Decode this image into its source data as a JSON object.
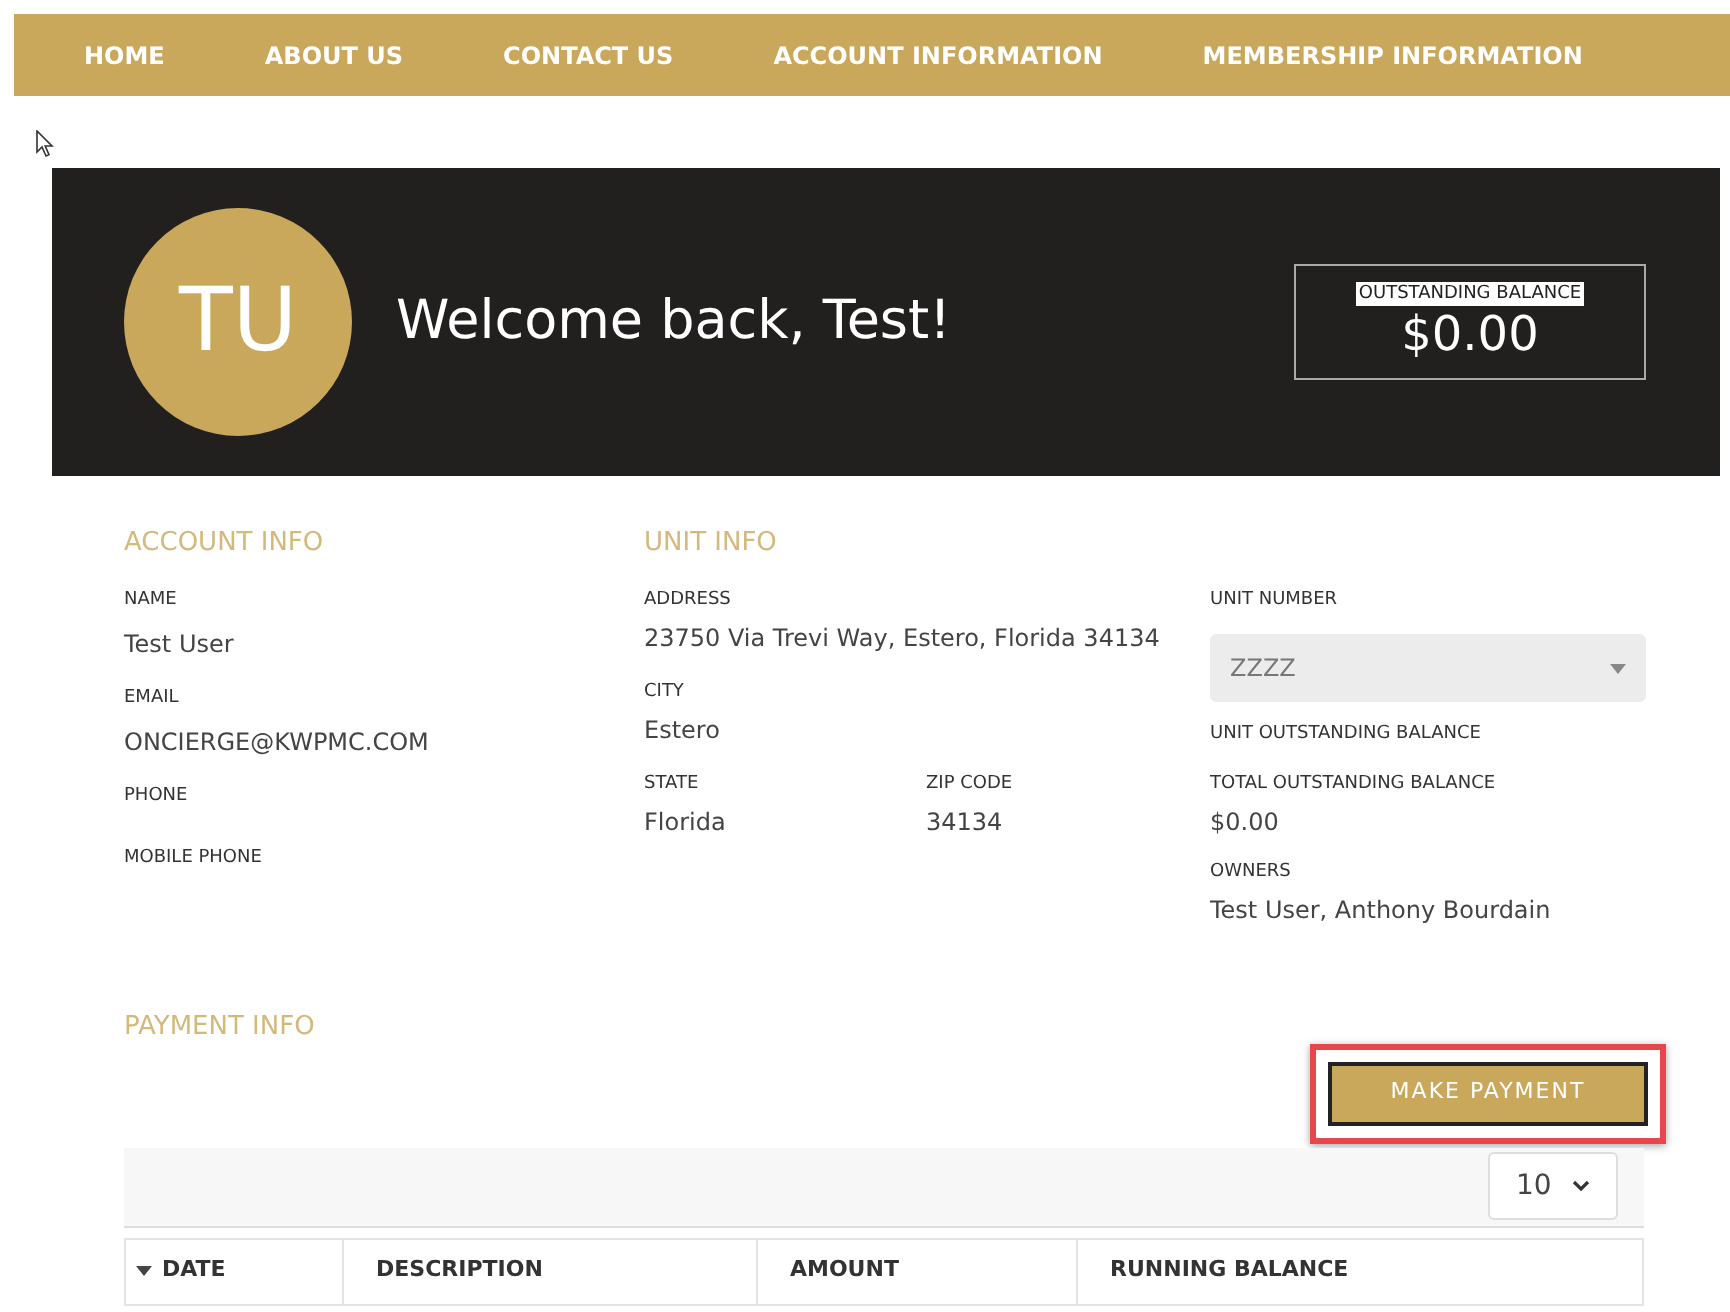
{
  "nav": [
    {
      "label": "HOME"
    },
    {
      "label": "ABOUT US"
    },
    {
      "label": "CONTACT US"
    },
    {
      "label": "ACCOUNT INFORMATION"
    },
    {
      "label": "MEMBERSHIP INFORMATION"
    }
  ],
  "banner": {
    "initials": "TU",
    "welcome": "Welcome back, Test!",
    "balance_label": "OUTSTANDING BALANCE",
    "balance_label_text_selected": true,
    "balance": "$0.00"
  },
  "account_info": {
    "title": "ACCOUNT INFO",
    "fields": [
      {
        "label": "NAME",
        "value": "Test User"
      },
      {
        "label": "EMAIL",
        "value": "ONCIERGE@KWPMC.COM"
      },
      {
        "label": "PHONE"
      },
      {
        "label": "MOBILE PHONE"
      }
    ]
  },
  "unit_info": {
    "title": "UNIT INFO",
    "address_label": "ADDRESS",
    "address": "23750 Via Trevi Way, Estero, Florida 34134",
    "city_label": "CITY",
    "city": "Estero",
    "state_label": "STATE",
    "state": "Florida",
    "zip_label": "ZIP CODE",
    "zip": "34134"
  },
  "unit_panel": {
    "unit_number_label": "UNIT NUMBER",
    "unit_number": "ZZZZ",
    "unit_balance_label": "UNIT OUTSTANDING BALANCE",
    "total_balance_label": "TOTAL OUTSTANDING BALANCE",
    "total_balance": "$0.00",
    "owners_label": "OWNERS",
    "owners": "Test User, Anthony Bourdain"
  },
  "payment_info": {
    "title": "PAYMENT INFO",
    "button": "MAKE PAYMENT",
    "button_highlighted": true,
    "page_size": "10",
    "columns": [
      {
        "label": "DATE",
        "sorted": true
      },
      {
        "label": "DESCRIPTION",
        "sorted": false
      },
      {
        "label": "AMOUNT",
        "sorted": false
      },
      {
        "label": "RUNNING BALANCE",
        "sorted": false
      }
    ]
  }
}
